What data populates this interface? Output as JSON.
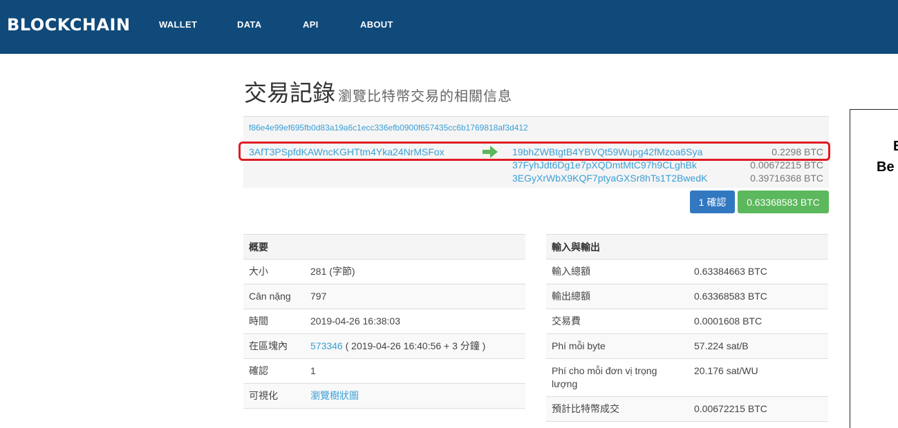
{
  "header": {
    "brand": "BLOCKCHAIN",
    "nav": [
      "WALLET",
      "DATA",
      "API",
      "ABOUT"
    ],
    "bg_color": "#0f4a7a"
  },
  "page": {
    "title": "交易記錄",
    "subtitle": "瀏覽比特幣交易的相關信息"
  },
  "transaction": {
    "hash": "f86e4e99ef695fb0d83a19a6c1ecc336efb0900f657435cc6b1769818af3d412",
    "input": "3AfT3PSpfdKAWncKGHTtm4Yka24NrMSFox",
    "arrow_icon": "arrow-right-icon",
    "outputs": [
      {
        "address": "19bhZWBtgtB4YBVQt59Wupg42fMzoa6Sya",
        "amount": "0.2298 BTC"
      },
      {
        "address": "37FyhJdt6Dg1e7pXQDmtMtC97h9CLghBk",
        "amount": "0.00672215 BTC"
      },
      {
        "address": "3EGyXrWbX9KQF7ptyaGXSr8hTs1T2BwedK",
        "amount": "0.39716368 BTC"
      }
    ],
    "confirm_button": "1 確認",
    "total_button": "0.63368583 BTC",
    "highlight_color": "#e01b23"
  },
  "summary": {
    "header": "概要",
    "rows": [
      {
        "label": "大小",
        "value": "281 (字節)"
      },
      {
        "label": "Cân nặng",
        "value": "797"
      },
      {
        "label": "時間",
        "value": "2019-04-26 16:38:03"
      },
      {
        "label": "在區塊內",
        "link": "573346",
        "value": " ( 2019-04-26 16:40:56 + 3 分鐘 )"
      },
      {
        "label": "確認",
        "value": "1"
      },
      {
        "label": "可視化",
        "link": "瀏覽樹狀圖"
      }
    ]
  },
  "io": {
    "header": "輸入與輸出",
    "rows": [
      {
        "label": "輸入總額",
        "value": "0.63384663 BTC"
      },
      {
        "label": "輸出總額",
        "value": "0.63368583 BTC"
      },
      {
        "label": "交易費",
        "value": "0.0001608 BTC"
      },
      {
        "label": "Phí mỗi byte",
        "value": "57.224 sat/B"
      },
      {
        "label": "Phí cho mỗi đơn vị trọng lượng",
        "value": "20.176 sat/WU"
      },
      {
        "label": "預計比特幣成交",
        "value": "0.00672215 BTC"
      }
    ]
  },
  "sidebar": {
    "line1": "B",
    "line2": "Be"
  }
}
